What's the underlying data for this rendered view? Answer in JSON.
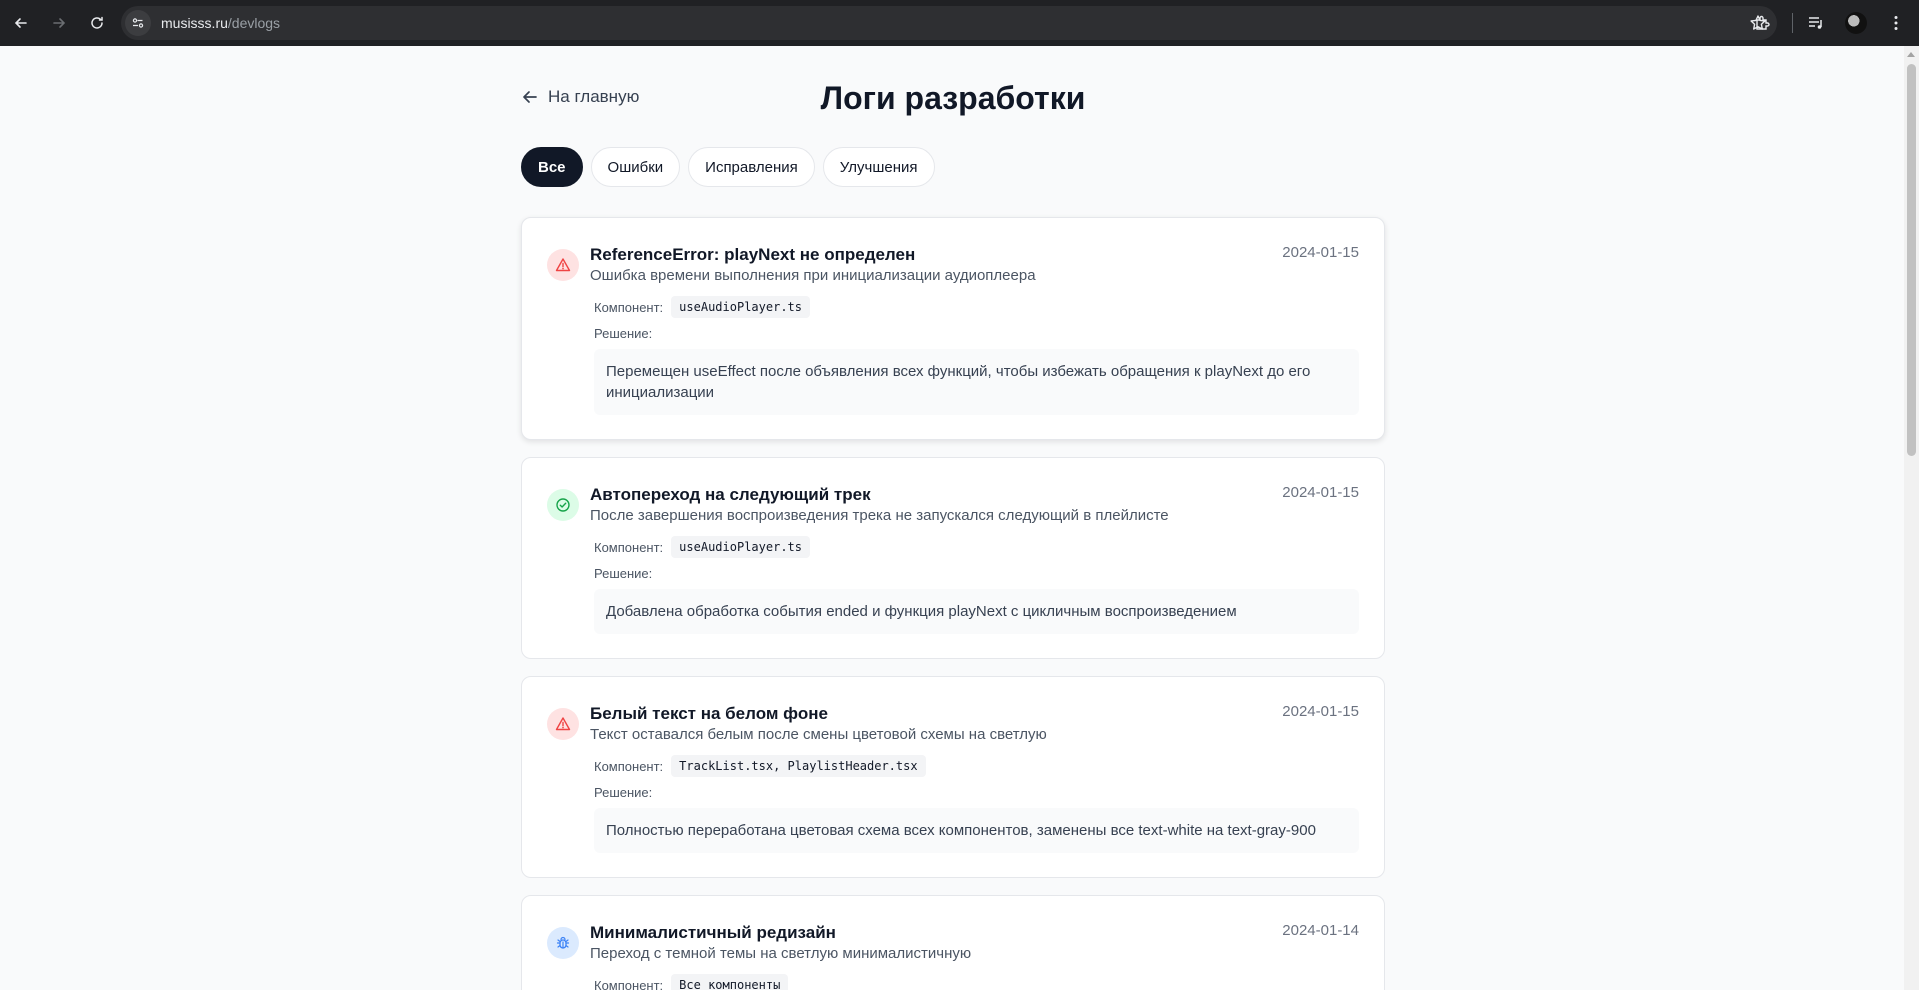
{
  "browser": {
    "url_host": "musisss.ru",
    "url_path": "/devlogs"
  },
  "page": {
    "back_label": "На главную",
    "title": "Логи разработки",
    "filters": [
      {
        "label": "Все",
        "active": true
      },
      {
        "label": "Ошибки",
        "active": false
      },
      {
        "label": "Исправления",
        "active": false
      },
      {
        "label": "Улучшения",
        "active": false
      }
    ],
    "component_label": "Компонент:",
    "solution_label": "Решение:"
  },
  "logs": [
    {
      "type": "error",
      "icon": "warning-triangle-icon",
      "title": "ReferenceError: playNext не определен",
      "description": "Ошибка времени выполнения при инициализации аудиоплеера",
      "date": "2024-01-15",
      "component": "useAudioPlayer.ts",
      "solution": "Перемещен useEffect после объявления всех функций, чтобы избежать обращения к playNext до его инициализации"
    },
    {
      "type": "fix",
      "icon": "check-circle-icon",
      "title": "Автопереход на следующий трек",
      "description": "После завершения воспроизведения трека не запускался следующий в плейлисте",
      "date": "2024-01-15",
      "component": "useAudioPlayer.ts",
      "solution": "Добавлена обработка события ended и функция playNext с цикличным воспроизведением"
    },
    {
      "type": "error",
      "icon": "warning-triangle-icon",
      "title": "Белый текст на белом фоне",
      "description": "Текст оставался белым после смены цветовой схемы на светлую",
      "date": "2024-01-15",
      "component": "TrackList.tsx, PlaylistHeader.tsx",
      "solution": "Полностью переработана цветовая схема всех компонентов, заменены все text-white на text-gray-900"
    },
    {
      "type": "improve",
      "icon": "bug-icon",
      "title": "Минималистичный редизайн",
      "description": "Переход с темной темы на светлую минималистичную",
      "date": "2024-01-14",
      "component": "Все компоненты",
      "solution": ""
    }
  ],
  "colors": {
    "error": "#ef4444",
    "fix": "#16a34a",
    "improve": "#3b82f6",
    "active_pill": "#111827"
  }
}
